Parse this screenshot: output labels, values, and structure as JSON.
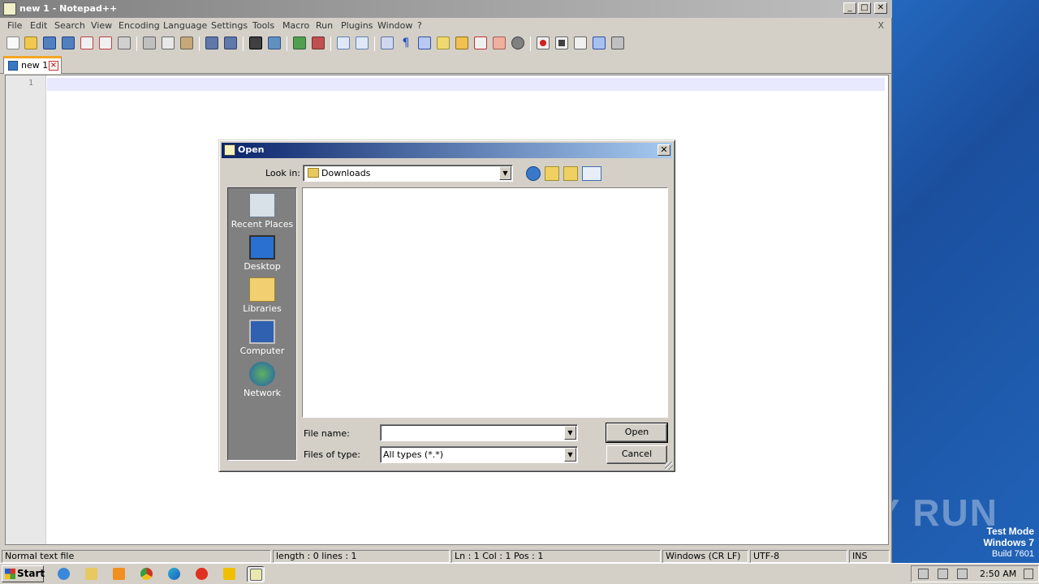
{
  "desktop": {
    "watermark": "ANY RUN",
    "test_mode_line1": "Test Mode",
    "test_mode_line2": "Windows 7",
    "test_mode_line3": "Build 7601"
  },
  "app": {
    "title": "new 1 - Notepad++",
    "menu": [
      "File",
      "Edit",
      "Search",
      "View",
      "Encoding",
      "Language",
      "Settings",
      "Tools",
      "Macro",
      "Run",
      "Plugins",
      "Window",
      "?"
    ],
    "menu_close": "X",
    "tab_label": "new 1",
    "line_number": "1",
    "status": {
      "file_type": "Normal text file",
      "length_lines": "length : 0    lines : 1",
      "position": "Ln : 1    Col : 1    Pos : 1",
      "eol": "Windows (CR LF)",
      "encoding": "UTF-8",
      "mode": "INS"
    }
  },
  "dialog": {
    "title": "Open",
    "look_in_label": "Look in:",
    "look_in_value": "Downloads",
    "places": [
      "Recent Places",
      "Desktop",
      "Libraries",
      "Computer",
      "Network"
    ],
    "file_name_label": "File name:",
    "file_name_value": "",
    "files_of_type_label": "Files of type:",
    "files_of_type_value": "All types (*.*)",
    "open_button": "Open",
    "cancel_button": "Cancel"
  },
  "taskbar": {
    "start_label": "Start",
    "clock": "2:50 AM"
  }
}
